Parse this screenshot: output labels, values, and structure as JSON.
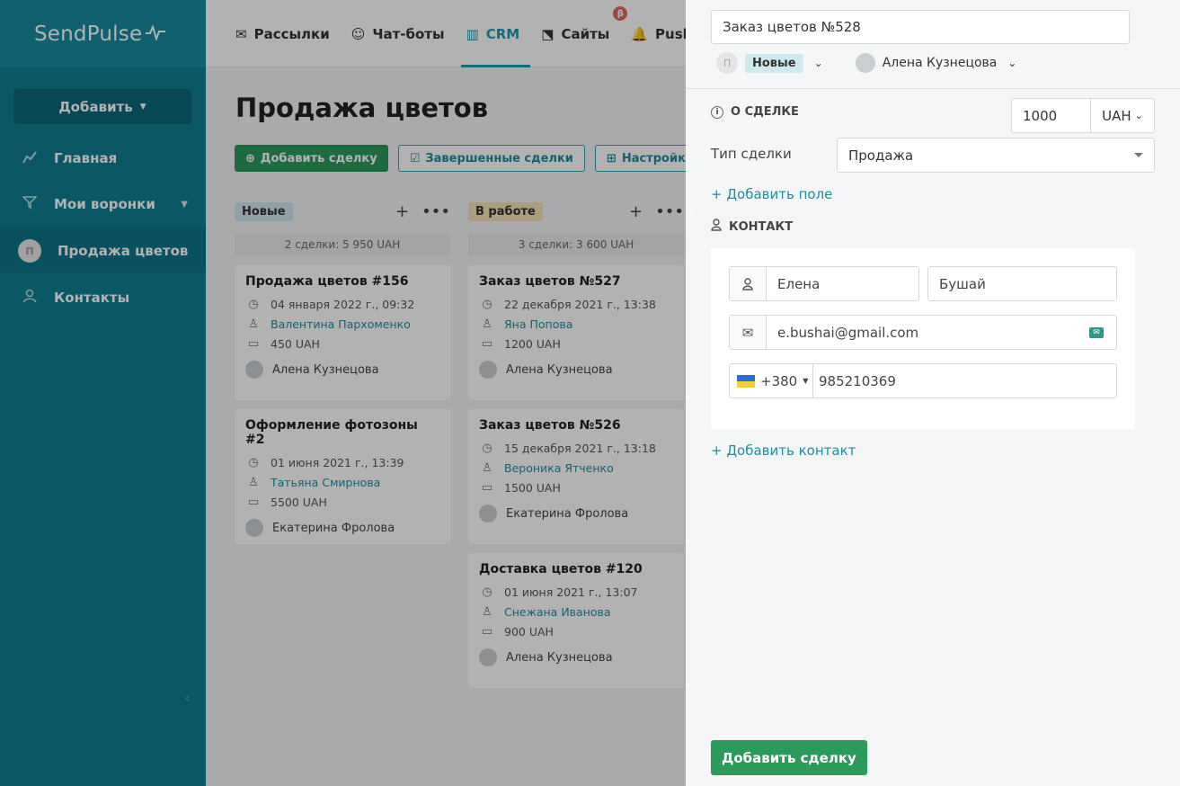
{
  "app": {
    "logo": "SendPulse",
    "logo_pulse": "⁄\\⁄"
  },
  "sidebar": {
    "add_label": "Добавить",
    "items": [
      {
        "label": "Главная",
        "icon": "chart-icon"
      },
      {
        "label": "Мои воронки",
        "icon": "funnel-icon"
      },
      {
        "label": "Продажа цветов",
        "avatar": "П"
      },
      {
        "label": "Контакты",
        "icon": "contacts-icon"
      }
    ]
  },
  "topnav": {
    "tabs": [
      {
        "label": "Рассылки",
        "icon": "✉"
      },
      {
        "label": "Чат-боты",
        "icon": "☺"
      },
      {
        "label": "CRM",
        "icon": "▥"
      },
      {
        "label": "Сайты",
        "icon": "⬔",
        "badge": "β"
      },
      {
        "label": "Push",
        "icon": "🔔"
      }
    ]
  },
  "main": {
    "title": "Продажа цветов",
    "toolbar": {
      "add_deal": "Добавить сделку",
      "completed": "Завершенные сделки",
      "settings": "Настройки"
    },
    "columns": [
      {
        "tag": "Новые",
        "summary": "2 сделки: 5 950 UAH",
        "cards": [
          {
            "title": "Продажа цветов #156",
            "date": "04 января 2022 г., 09:32",
            "contact": "Валентина Пархоменко",
            "amount": "450 UAH",
            "owner": "Алена Кузнецова"
          },
          {
            "title": "Оформление фотозоны #2",
            "date": "01 июня 2021 г., 13:39",
            "contact": "Татьяна Смирнова",
            "amount": "5500 UAH",
            "owner": "Екатерина Фролова"
          }
        ]
      },
      {
        "tag": "В работе",
        "summary": "3 сделки: 3 600 UAH",
        "cards": [
          {
            "title": "Заказ цветов №527",
            "date": "22 декабря 2021 г., 13:38",
            "contact": "Яна Попова",
            "amount": "1200 UAH",
            "owner": "Алена Кузнецова"
          },
          {
            "title": "Заказ цветов №526",
            "date": "15 декабря 2021 г., 13:18",
            "contact": "Вероника Ятченко",
            "amount": "1500 UAH",
            "owner": "Екатерина Фролова"
          },
          {
            "title": "Доставка цветов #120",
            "date": "01 июня 2021 г., 13:07",
            "contact": "Снежана Иванова",
            "amount": "900 UAH",
            "owner": "Алена Кузнецова"
          }
        ]
      }
    ]
  },
  "panel": {
    "deal_name": "Заказ цветов №528",
    "stage_avatar": "П",
    "stage": "Новые",
    "owner": "Алена Кузнецова",
    "about_label": "О СДЕЛКЕ",
    "amount_value": "1000",
    "currency": "UAH",
    "type_label": "Тип сделки",
    "type_value": "Продажа",
    "add_field": "+ Добавить поле",
    "contact_label": "КОНТАКТ",
    "first_name": "Елена",
    "last_name": "Бушай",
    "email": "e.bushai@gmail.com",
    "phone_code": "+380",
    "phone": "985210369",
    "add_contact": "+ Добавить контакт",
    "submit": "Добавить сделку"
  }
}
